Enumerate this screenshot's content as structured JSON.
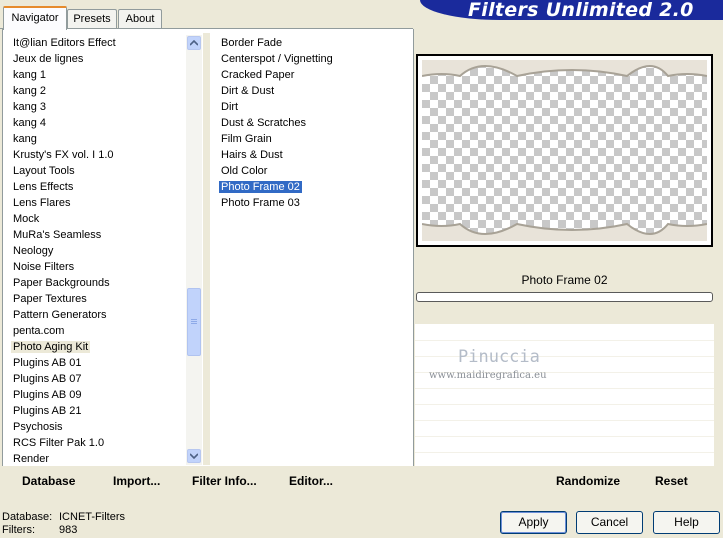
{
  "tabs": [
    {
      "label": "Navigator",
      "active": true
    },
    {
      "label": "Presets",
      "active": false
    },
    {
      "label": "About",
      "active": false
    }
  ],
  "app_title": "Filters Unlimited 2.0",
  "categories": [
    "It@lian Editors Effect",
    "Jeux de lignes",
    "kang 1",
    "kang 2",
    "kang 3",
    "kang 4",
    "kang",
    "Krusty's FX vol. I 1.0",
    "Layout Tools",
    "Lens Effects",
    "Lens Flares",
    "Mock",
    "MuRa's Seamless",
    "Neology",
    "Noise Filters",
    "Paper Backgrounds",
    "Paper Textures",
    "Pattern Generators",
    "penta.com",
    "Photo Aging Kit",
    "Plugins AB 01",
    "Plugins AB 07",
    "Plugins AB 09",
    "Plugins AB 21",
    "Psychosis",
    "RCS Filter Pak 1.0",
    "Render"
  ],
  "selected_category": "Photo Aging Kit",
  "filters": [
    "Border Fade",
    "Centerspot / Vignetting",
    "Cracked Paper",
    "Dirt & Dust",
    "Dirt",
    "Dust & Scratches",
    "Film Grain",
    "Hairs & Dust",
    "Old Color",
    "Photo Frame 02",
    "Photo Frame 03"
  ],
  "selected_filter": "Photo Frame 02",
  "preview_filter_name": "Photo Frame 02",
  "watermark": {
    "name": "Pinuccia",
    "url": "www.maidiregrafica.eu"
  },
  "left_bar": {
    "database": "Database",
    "import": "Import...",
    "filter_info": "Filter Info...",
    "editor": "Editor..."
  },
  "right_bar": {
    "randomize": "Randomize",
    "reset": "Reset"
  },
  "status": {
    "database_label": "Database:",
    "database_value": "ICNET-Filters",
    "filters_label": "Filters:",
    "filters_value": "983"
  },
  "buttons": {
    "apply": "Apply",
    "cancel": "Cancel",
    "help": "Help"
  },
  "colors": {
    "selection": "#316ac5",
    "title_banner": "#1a2a9c",
    "tab_accent": "#e68b2c",
    "frame_color": "#e8e3d9"
  }
}
